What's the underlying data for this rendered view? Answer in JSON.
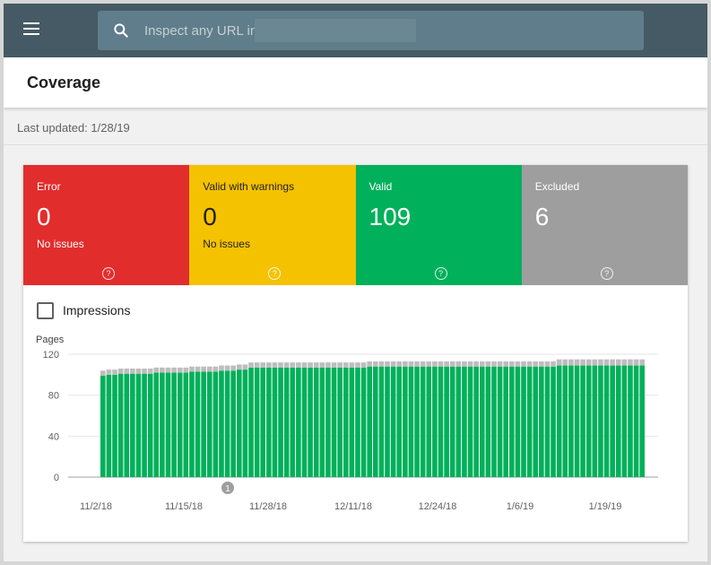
{
  "search": {
    "placeholder": "Inspect any URL in"
  },
  "page": {
    "title": "Coverage",
    "last_updated": "Last updated: 1/28/19"
  },
  "tiles": [
    {
      "label": "Error",
      "value": "0",
      "sub": "No issues",
      "color": "#e22d2d"
    },
    {
      "label": "Valid with warnings",
      "value": "0",
      "sub": "No issues",
      "color": "#f5c200"
    },
    {
      "label": "Valid",
      "value": "109",
      "sub": "",
      "color": "#00b05a"
    },
    {
      "label": "Excluded",
      "value": "6",
      "sub": "",
      "color": "#9e9e9e"
    }
  ],
  "impressions": {
    "label": "Impressions",
    "checked": false
  },
  "chart_data": {
    "type": "bar",
    "stacked": true,
    "ylabel": "Pages",
    "ylim": [
      0,
      120
    ],
    "yticks": [
      0,
      40,
      80,
      120
    ],
    "xticks": [
      "11/2/18",
      "11/15/18",
      "11/28/18",
      "12/11/18",
      "12/24/18",
      "1/6/19",
      "1/19/19"
    ],
    "annotation": "1",
    "series": [
      {
        "color": "#00b05a",
        "values": [
          99,
          100,
          100,
          101,
          101,
          101,
          101,
          101,
          101,
          102,
          102,
          102,
          102,
          102,
          102,
          103,
          103,
          103,
          103,
          103,
          104,
          104,
          104,
          105,
          105,
          107,
          107,
          107,
          107,
          107,
          107,
          107,
          107,
          107,
          107,
          107,
          107,
          107,
          107,
          107,
          107,
          107,
          107,
          107,
          107,
          108,
          108,
          108,
          108,
          108,
          108,
          108,
          108,
          108,
          108,
          108,
          108,
          108,
          108,
          108,
          108,
          108,
          108,
          108,
          108,
          108,
          108,
          108,
          108,
          108,
          108,
          108,
          108,
          108,
          108,
          108,
          108,
          109,
          109,
          109,
          109,
          109,
          109,
          109,
          109,
          109,
          109,
          109,
          109,
          109,
          109,
          109
        ]
      },
      {
        "color": "#bdbdbd",
        "values": [
          5,
          5,
          5,
          5,
          5,
          5,
          5,
          5,
          5,
          5,
          5,
          5,
          5,
          5,
          5,
          5,
          5,
          5,
          5,
          5,
          5,
          5,
          5,
          5,
          5,
          5,
          5,
          5,
          5,
          5,
          5,
          5,
          5,
          5,
          5,
          5,
          5,
          5,
          5,
          5,
          5,
          5,
          5,
          5,
          5,
          5,
          5,
          5,
          5,
          5,
          5,
          5,
          5,
          5,
          5,
          5,
          5,
          5,
          5,
          5,
          5,
          5,
          5,
          5,
          5,
          5,
          5,
          5,
          5,
          5,
          5,
          5,
          5,
          5,
          5,
          5,
          5,
          6,
          6,
          6,
          6,
          6,
          6,
          6,
          6,
          6,
          6,
          6,
          6,
          6,
          6,
          6
        ]
      }
    ]
  }
}
